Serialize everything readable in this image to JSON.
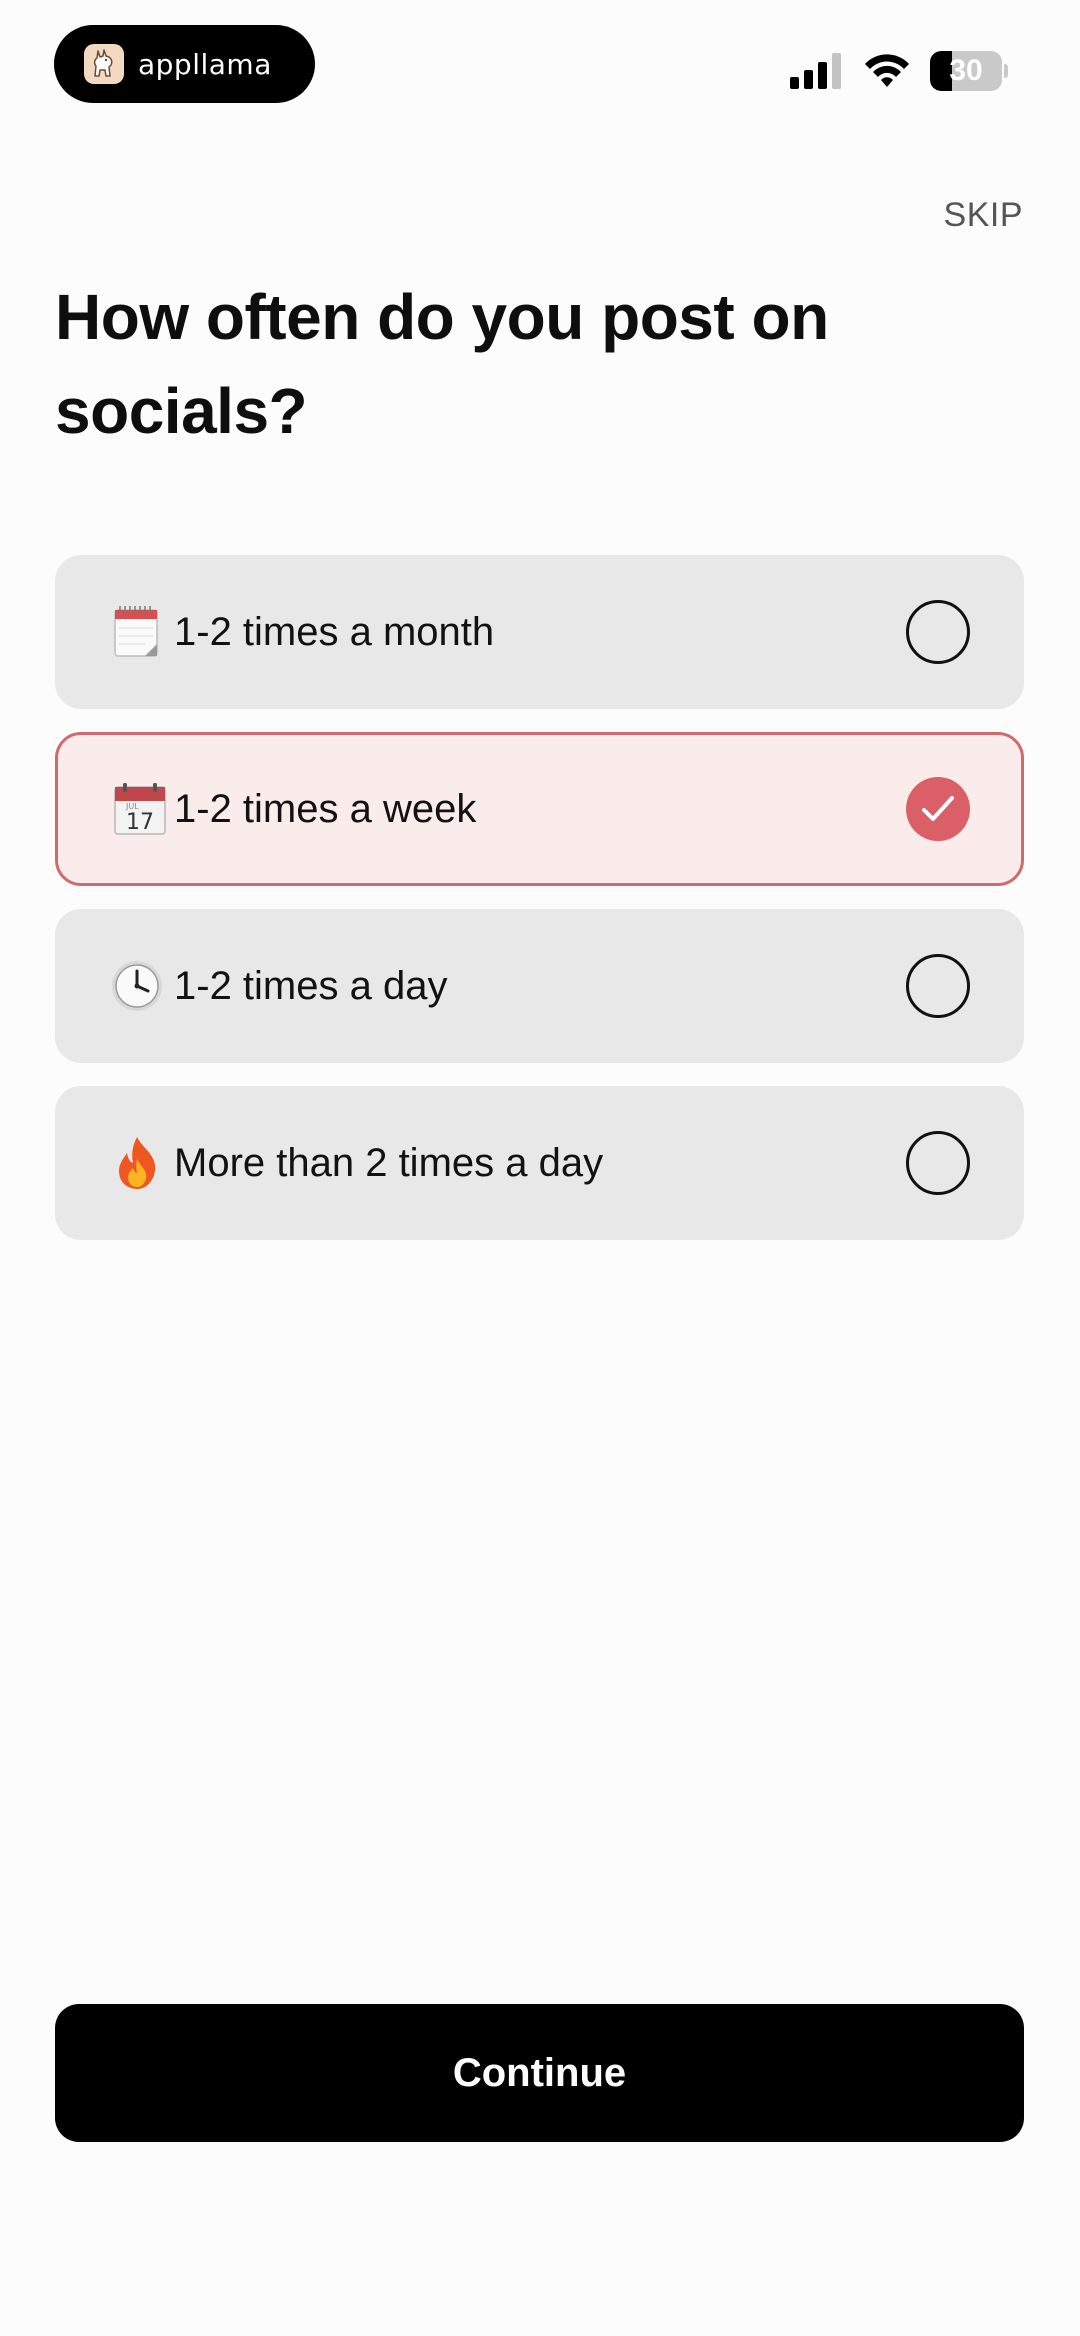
{
  "status_bar": {
    "app_name": "appllama",
    "battery_level": "30",
    "battery_fraction": 0.3
  },
  "header": {
    "skip_label": "SKIP"
  },
  "question": {
    "title": "How often do you post on socials?"
  },
  "options": [
    {
      "label": "1-2 times a month",
      "icon": "spiral-calendar-icon",
      "selected": false
    },
    {
      "label": "1-2 times a week",
      "icon": "calendar-icon",
      "selected": true
    },
    {
      "label": "1-2 times a day",
      "icon": "clock-icon",
      "selected": false
    },
    {
      "label": "More than 2 times a day",
      "icon": "fire-icon",
      "selected": false
    }
  ],
  "footer": {
    "continue_label": "Continue"
  },
  "colors": {
    "selected_background": "#fbecec",
    "selected_border": "#d06a6e",
    "check_fill": "#db5f66",
    "option_background": "#e8e8e8",
    "primary_button": "#000000"
  }
}
